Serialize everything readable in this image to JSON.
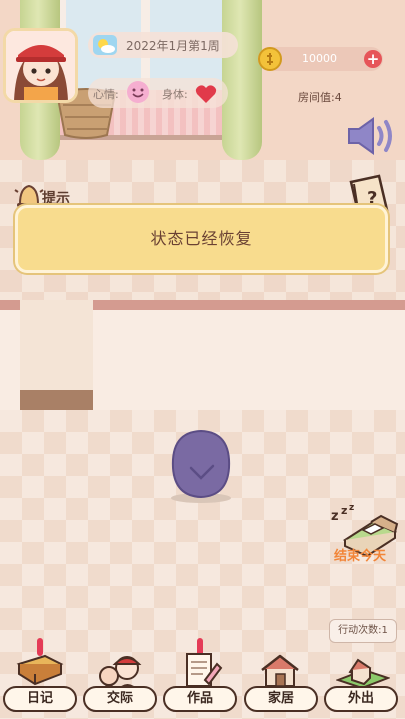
{
  "header": {
    "date": "2022年1月第1周",
    "mood_label": "心情:",
    "body_label": "身体:",
    "coins": "10000",
    "room_value": "房间值:4"
  },
  "hint": {
    "label": "提示",
    "message": "状态已经恢复"
  },
  "sleep": {
    "label": "结束今天"
  },
  "action_count": "行动次数:1",
  "nav": [
    {
      "label": "日记",
      "icon": "diary-icon"
    },
    {
      "label": "交际",
      "icon": "social-icon"
    },
    {
      "label": "作品",
      "icon": "works-icon"
    },
    {
      "label": "家居",
      "icon": "home-icon"
    },
    {
      "label": "外出",
      "icon": "outing-icon"
    }
  ],
  "colors": {
    "hint_bg": "#f8dc8e",
    "sleep_text": "#f28538",
    "badge": "#e43b56",
    "heart": "#e13a4a",
    "mood_face": "#f5aed0"
  }
}
